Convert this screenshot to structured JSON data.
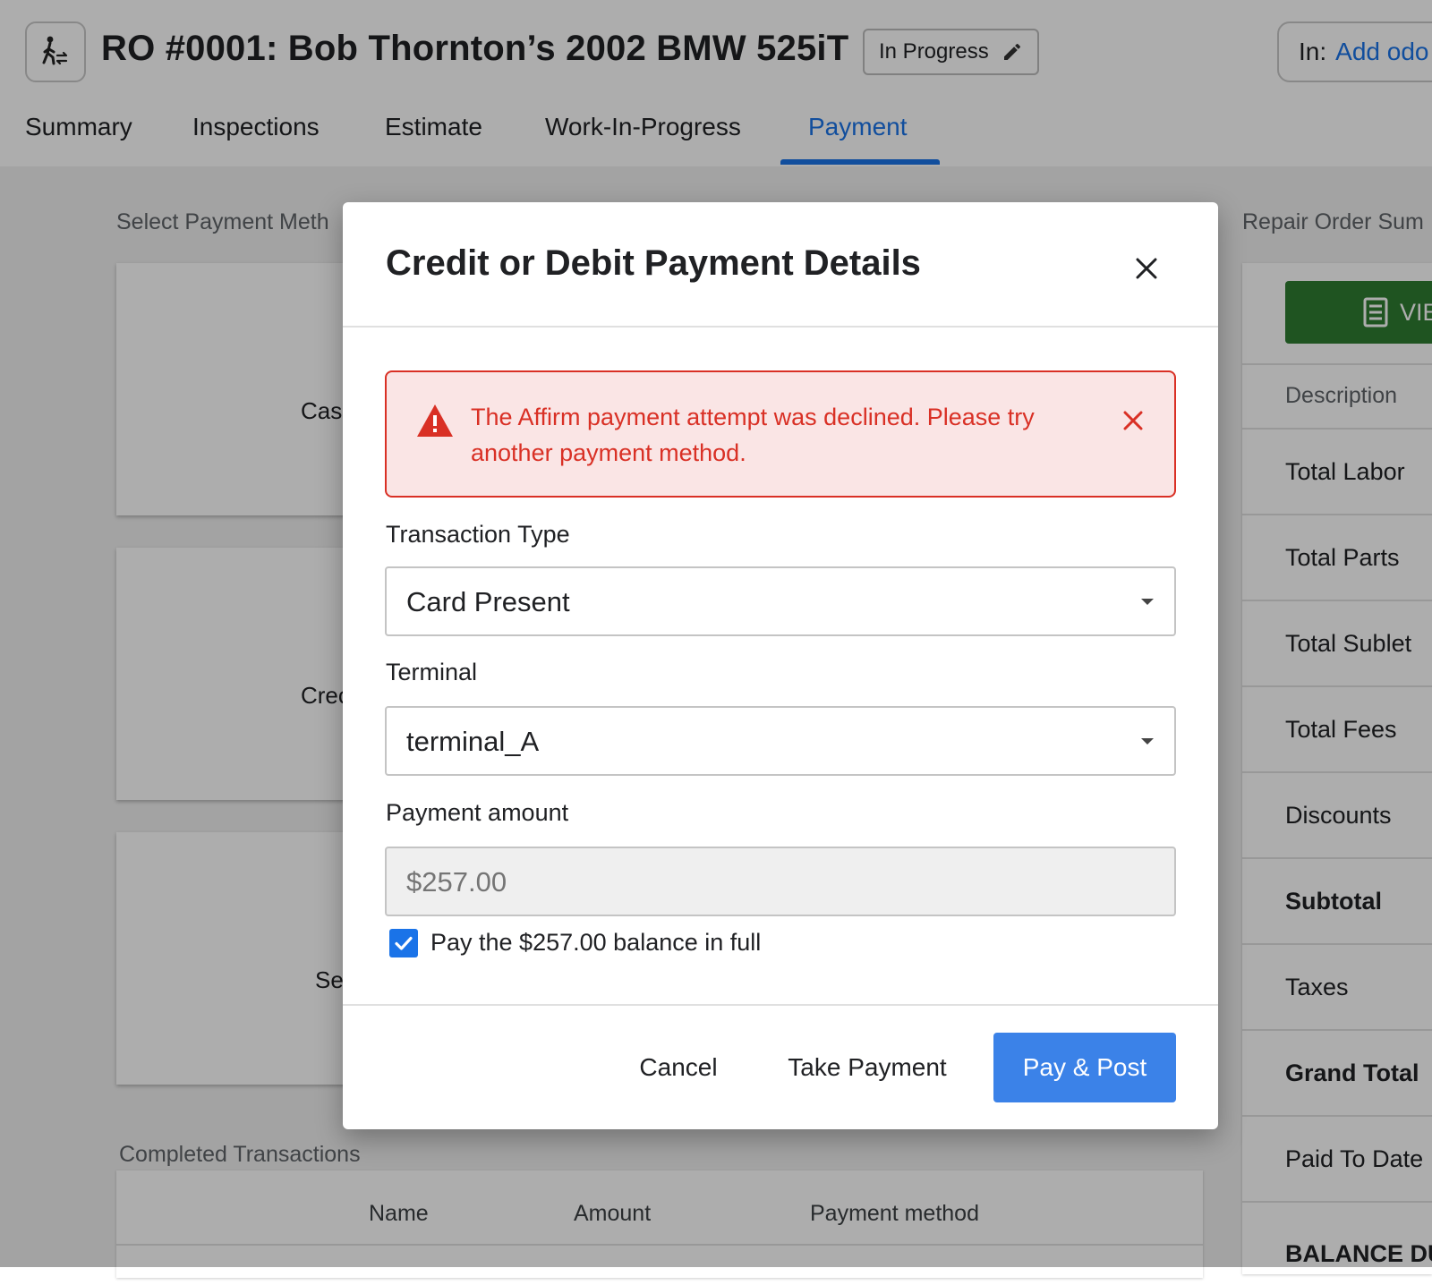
{
  "header": {
    "ro_title": "RO #0001: Bob Thornton’s 2002 BMW 525iT",
    "status": "In Progress",
    "odometer_prefix": "In:",
    "odometer_link": "Add odo"
  },
  "tabs": [
    "Summary",
    "Inspections",
    "Estimate",
    "Work-In-Progress",
    "Payment"
  ],
  "active_tab": "Payment",
  "background": {
    "select_payment_method_label": "Select Payment Meth",
    "method_cards": [
      "Cas",
      "Crec",
      "Se"
    ],
    "completed_transactions_label": "Completed Transactions",
    "transactions_table": {
      "columns": [
        "Name",
        "Amount",
        "Payment method"
      ]
    },
    "repair_order_summary": {
      "label": "Repair Order Sum",
      "view_button": "VIE",
      "header": "Description",
      "rows": [
        "Total Labor",
        "Total Parts",
        "Total Sublet",
        "Total Fees",
        "Discounts",
        "Subtotal",
        "Taxes",
        "Grand Total",
        "Paid To Date",
        "BALANCE DU"
      ]
    }
  },
  "modal": {
    "title": "Credit or Debit Payment Details",
    "alert": {
      "message": "The Affirm payment attempt was declined. Please try another payment method."
    },
    "transaction_type": {
      "label": "Transaction Type",
      "value": "Card Present"
    },
    "terminal": {
      "label": "Terminal",
      "value": "terminal_A"
    },
    "payment_amount": {
      "label": "Payment amount",
      "value": "$257.00"
    },
    "pay_in_full": {
      "label": "Pay the $257.00 balance in full",
      "checked": true
    },
    "buttons": {
      "cancel": "Cancel",
      "take_payment": "Take Payment",
      "pay_post": "Pay & Post"
    }
  },
  "colors": {
    "accent": "#1a73e8",
    "primary_button": "#3b82e8",
    "error": "#d93025",
    "error_bg": "#fae5e5",
    "view_button": "#2e7d32"
  },
  "icons": {
    "ro_button": "walk-in-icon",
    "status_edit": "pencil-icon",
    "view_button": "receipt-icon",
    "modal_close": "close-icon",
    "alert": "warning-triangle-icon",
    "alert_close": "close-icon",
    "select_caret": "caret-down-icon",
    "checkbox": "check-icon"
  }
}
